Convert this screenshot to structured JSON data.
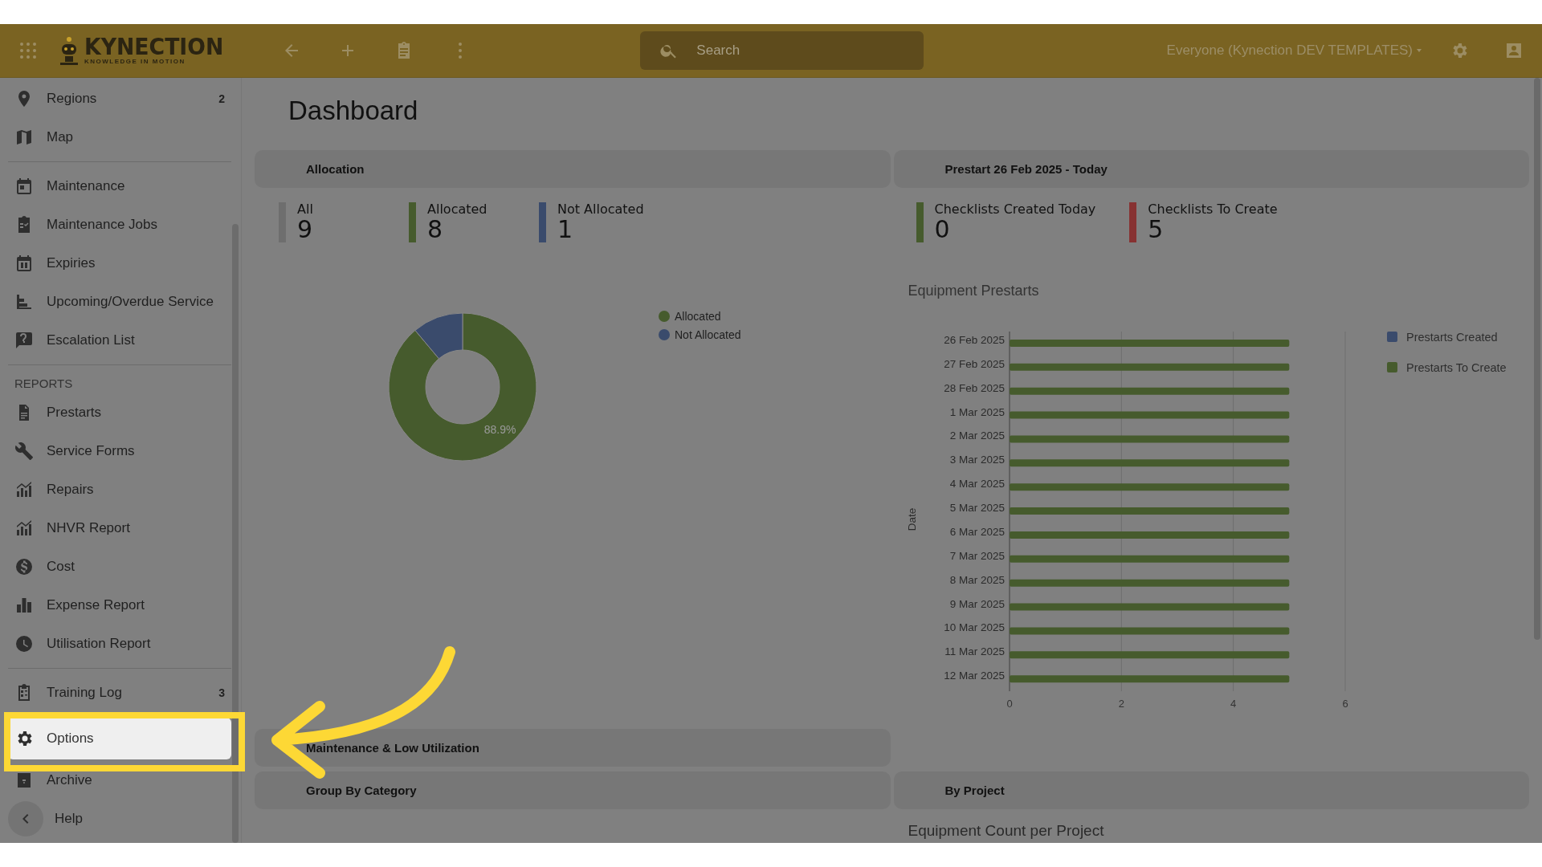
{
  "header": {
    "logo": {
      "name": "KYNECTION",
      "tagline": "KNOWLEDGE IN MOTION"
    },
    "search": {
      "placeholder": "Search"
    },
    "account": "Everyone (Kynection DEV TEMPLATES)"
  },
  "sidebar": {
    "sections": [
      {
        "items": [
          {
            "label": "Regions",
            "badge": "2",
            "selected": false
          },
          {
            "label": "Map",
            "selected": false
          }
        ]
      },
      {
        "items": [
          {
            "label": "Maintenance",
            "selected": false
          },
          {
            "label": "Maintenance Jobs",
            "selected": false
          },
          {
            "label": "Expiries",
            "selected": false
          },
          {
            "label": "Upcoming/Overdue Service",
            "selected": false
          },
          {
            "label": "Escalation List",
            "selected": false
          }
        ]
      },
      {
        "heading": "REPORTS",
        "items": [
          {
            "label": "Prestarts",
            "selected": false
          },
          {
            "label": "Service Forms",
            "selected": false
          },
          {
            "label": "Repairs",
            "selected": false
          },
          {
            "label": "NHVR Report",
            "selected": false
          },
          {
            "label": "Cost",
            "selected": false
          },
          {
            "label": "Expense Report",
            "selected": false
          },
          {
            "label": "Utilisation Report",
            "selected": false
          }
        ]
      },
      {
        "items": [
          {
            "label": "Training Log",
            "badge": "3",
            "selected": false
          },
          {
            "label": "Options",
            "selected": true
          },
          {
            "label": "Archive",
            "selected": false
          },
          {
            "label": "Help",
            "selected": false
          }
        ]
      }
    ]
  },
  "page": {
    "title": "Dashboard"
  },
  "widgets": [
    {
      "title": "Allocation",
      "stats": [
        {
          "label": "All",
          "value": "9",
          "color": "#6e6e6e"
        },
        {
          "label": "Allocated",
          "value": "8",
          "color": "#465b2d"
        },
        {
          "label": "Not Allocated",
          "value": "1",
          "color": "#3a4b6c"
        }
      ],
      "chart_data": {
        "type": "donut",
        "categories": [
          "Allocated",
          "Not Allocated"
        ],
        "values": [
          88.9,
          11.1
        ],
        "colors": [
          "#465b2d",
          "#3a4b6c"
        ],
        "value_labels": [
          "88.9%",
          null
        ],
        "legend": "right"
      }
    },
    {
      "title": "Prestart 26 Feb 2025 - Today",
      "stats": [
        {
          "label": "Checklists Created Today",
          "value": "0",
          "color": "#465b2d"
        },
        {
          "label": "Checklists To Create",
          "value": "5",
          "color": "#873232"
        }
      ],
      "chart_title": "Equipment Prestarts",
      "chart_data": {
        "type": "bar",
        "orientation": "horizontal",
        "ylabel": "Date",
        "categories": [
          "26 Feb 2025",
          "27 Feb 2025",
          "28 Feb 2025",
          "1 Mar 2025",
          "2 Mar 2025",
          "3 Mar 2025",
          "4 Mar 2025",
          "5 Mar 2025",
          "6 Mar 2025",
          "7 Mar 2025",
          "8 Mar 2025",
          "9 Mar 2025",
          "10 Mar 2025",
          "11 Mar 2025",
          "12 Mar 2025"
        ],
        "series": [
          {
            "name": "Prestarts Created",
            "color": "#3a4b6c",
            "values": [
              0,
              0,
              0,
              0,
              0,
              0,
              0,
              0,
              0,
              0,
              0,
              0,
              0,
              0,
              0
            ]
          },
          {
            "name": "Prestarts To Create",
            "color": "#465b2d",
            "values": [
              5,
              5,
              5,
              5,
              5,
              5,
              5,
              5,
              5,
              5,
              5,
              5,
              5,
              5,
              5
            ]
          }
        ],
        "xlim": [
          0,
          6
        ],
        "xticks": [
          {
            "value": 0,
            "label": "0"
          },
          {
            "value": 2,
            "label": "2"
          },
          {
            "value": 4,
            "label": "4"
          },
          {
            "value": 6,
            "label": "6"
          }
        ]
      }
    }
  ],
  "sections": [
    {
      "title": "Maintenance & Low Utilization"
    },
    {
      "title": "Group By Category"
    },
    {
      "title": "By Project",
      "subtitle": "Equipment Count per Project"
    }
  ]
}
